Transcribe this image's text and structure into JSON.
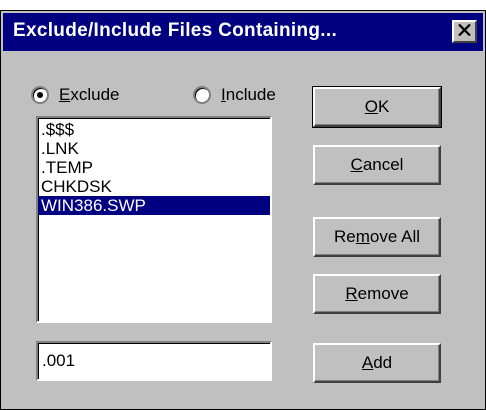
{
  "window": {
    "title": "Exclude/Include Files Containing..."
  },
  "radios": {
    "exclude": {
      "pre": "",
      "mnemonic": "E",
      "post": "xclude",
      "checked": true
    },
    "include": {
      "pre": "",
      "mnemonic": "I",
      "post": "nclude",
      "checked": false
    }
  },
  "list": {
    "items": [
      ".$$$",
      ".LNK",
      ".TEMP",
      "CHKDSK",
      "WIN386.SWP"
    ],
    "selected_index": 4
  },
  "input": {
    "value": ".001"
  },
  "buttons": {
    "ok": {
      "pre": "",
      "mnemonic": "O",
      "post": "K"
    },
    "cancel": {
      "pre": "",
      "mnemonic": "C",
      "post": "ancel"
    },
    "remove_all": {
      "pre": "Re",
      "mnemonic": "m",
      "post": "ove All"
    },
    "remove": {
      "pre": "",
      "mnemonic": "R",
      "post": "emove"
    },
    "add": {
      "pre": "",
      "mnemonic": "A",
      "post": "dd"
    }
  },
  "colors": {
    "title_bar": "#000080",
    "selection": "#000080",
    "face": "#c0c0c0"
  },
  "icons": {
    "close": "close-icon"
  }
}
